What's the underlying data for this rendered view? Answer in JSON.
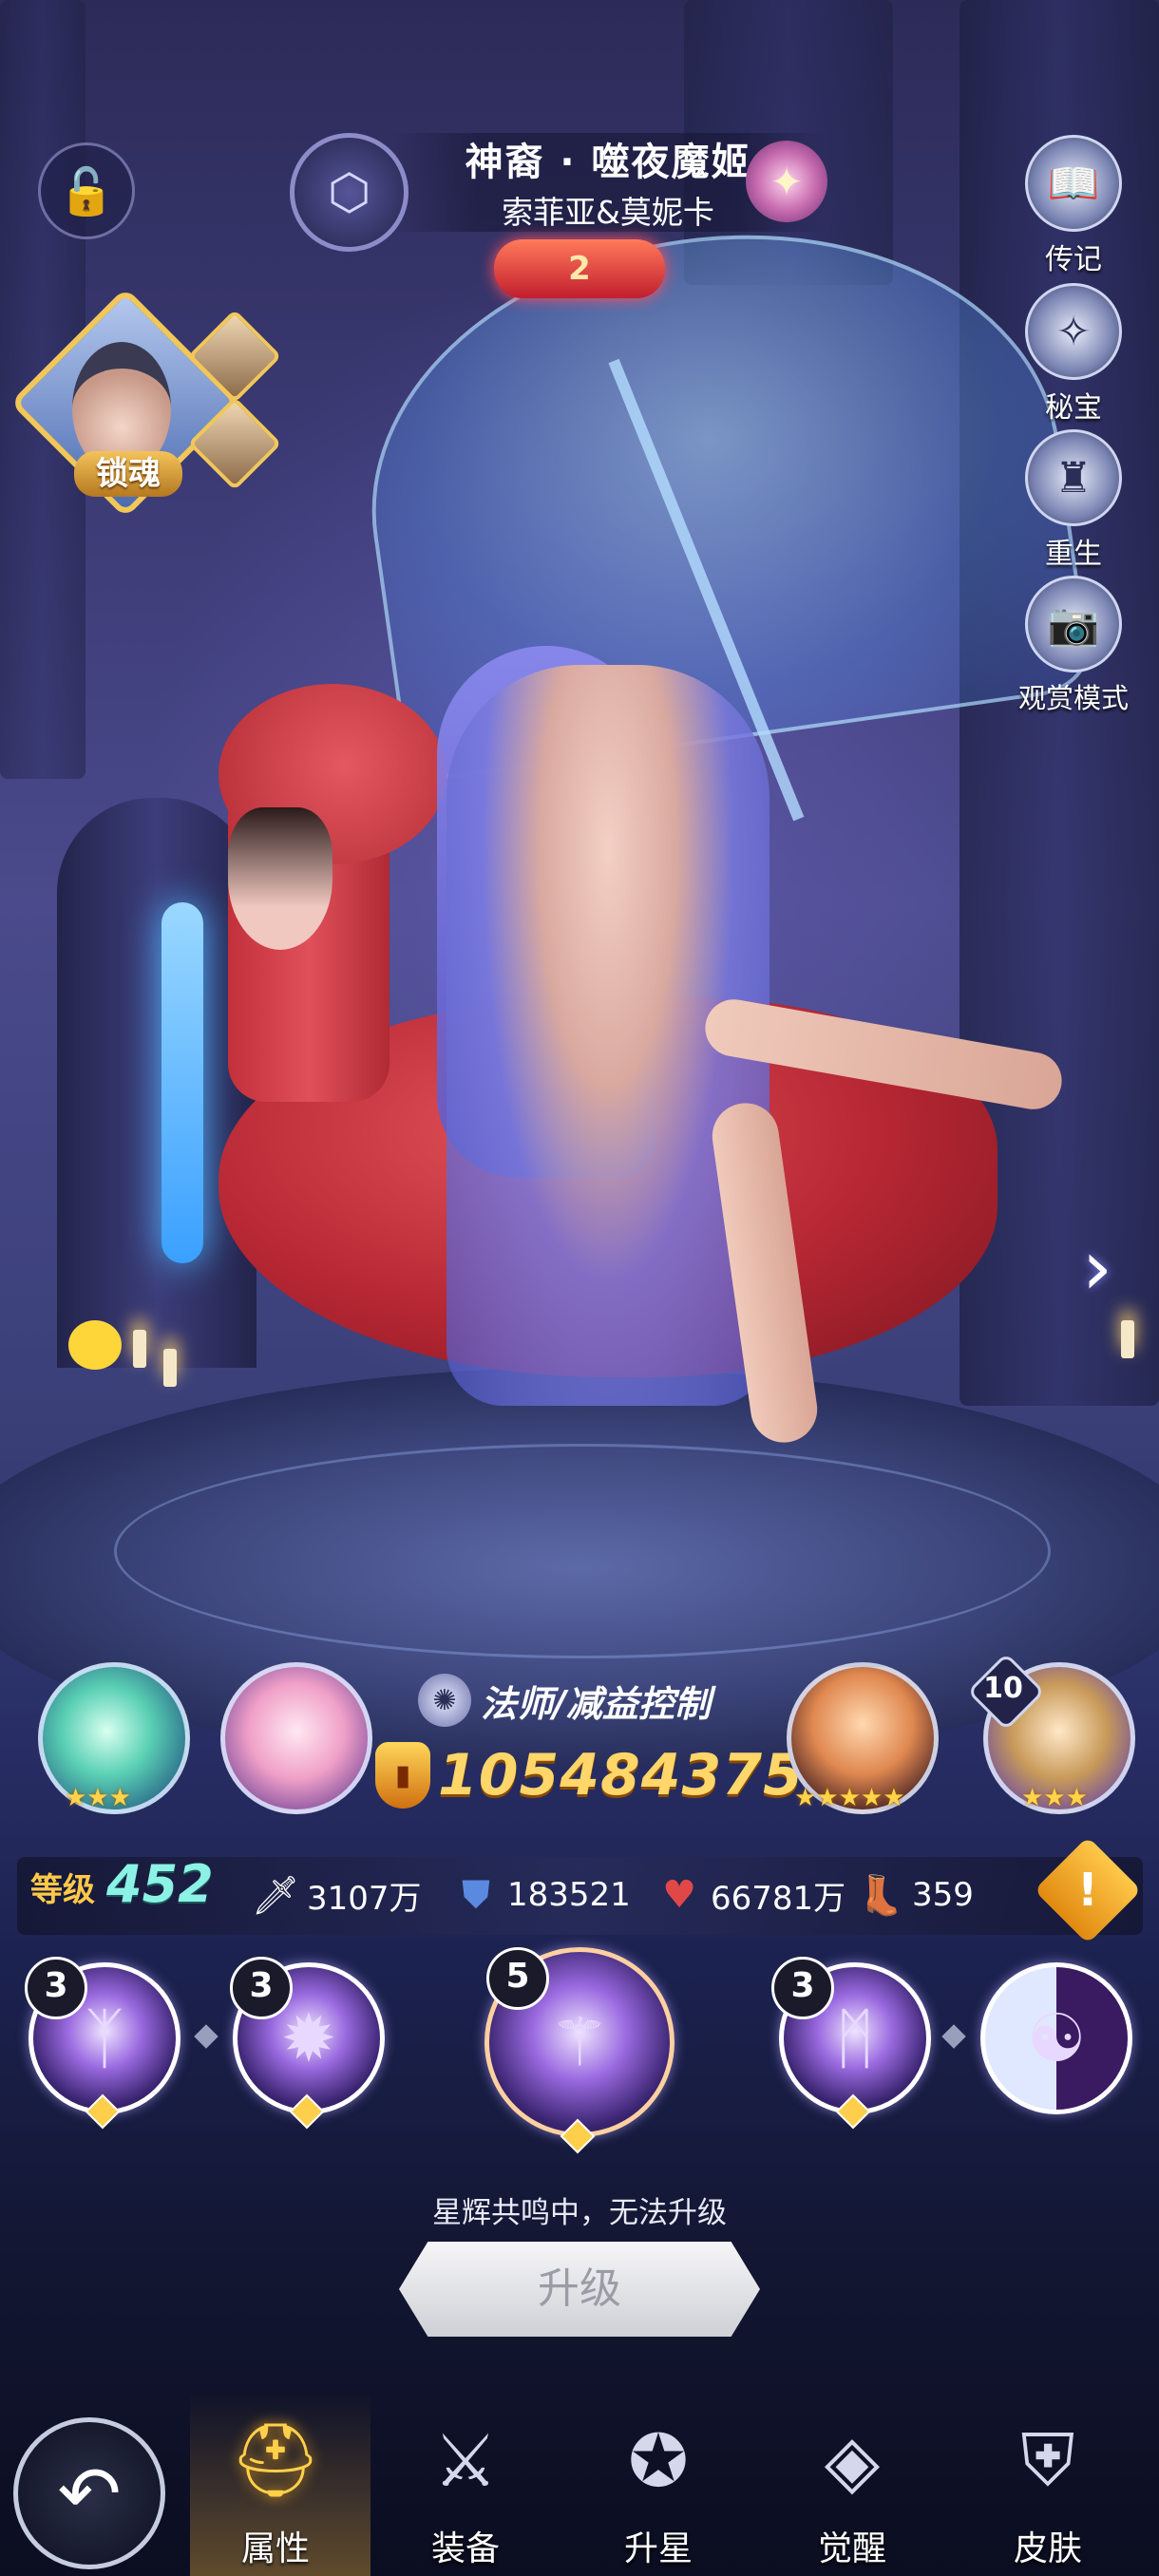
{
  "header": {
    "hero_name": "神裔 · 噬夜魔姬",
    "hero_subtitle": "索菲亚&莫妮卡",
    "rank_badge": "2",
    "icons": {
      "lock": "lock-open-icon",
      "faction": "faction-emblem-icon",
      "element": "light-element-icon"
    }
  },
  "soul_link": {
    "label": "锁魂"
  },
  "side_menu": [
    {
      "label": "传记",
      "icon": "book-icon"
    },
    {
      "label": "秘宝",
      "icon": "treasure-icon"
    },
    {
      "label": "重生",
      "icon": "rebirth-icon"
    },
    {
      "label": "观赏模式",
      "icon": "camera-icon"
    }
  ],
  "role": {
    "text": "法师/减益控制",
    "icon": "mage-icon"
  },
  "power": {
    "value": "105484375",
    "icon": "power-shield-icon"
  },
  "teammates": [
    {
      "name": "dragon-pet",
      "stars": 3
    },
    {
      "name": "pink-fairy",
      "stars": 0
    },
    {
      "name": "flame-hair-hero",
      "stars": 5
    },
    {
      "name": "treasure-chest-pet",
      "stars": 3,
      "badge": "10"
    }
  ],
  "stats": {
    "level_label": "等级",
    "level_value": "452",
    "attack": "3107万",
    "defense": "183521",
    "hp": "66781万",
    "speed": "359"
  },
  "skills": [
    {
      "level": "3",
      "icon": "claw-heart-skill-icon"
    },
    {
      "level": "3",
      "icon": "shadow-wing-skill-icon"
    },
    {
      "level": "5",
      "icon": "ultimate-skill-icon"
    },
    {
      "level": "3",
      "icon": "bat-wing-skill-icon"
    },
    {
      "level": "",
      "icon": "dual-soul-skill-icon"
    }
  ],
  "upgrade": {
    "note": "星辉共鸣中，无法升级",
    "button_label": "升级"
  },
  "bottom_nav": [
    {
      "label": "属性",
      "icon": "helmet-icon",
      "active": true
    },
    {
      "label": "装备",
      "icon": "sword-icon",
      "active": false
    },
    {
      "label": "升星",
      "icon": "star-shield-icon",
      "active": false
    },
    {
      "label": "觉醒",
      "icon": "awaken-icon",
      "active": false
    },
    {
      "label": "皮肤",
      "icon": "armor-icon",
      "active": false
    }
  ],
  "colors": {
    "accent_gold": "#ffd66a",
    "level_teal": "#8cf2e6",
    "bg_purple": "#3b3a74"
  }
}
